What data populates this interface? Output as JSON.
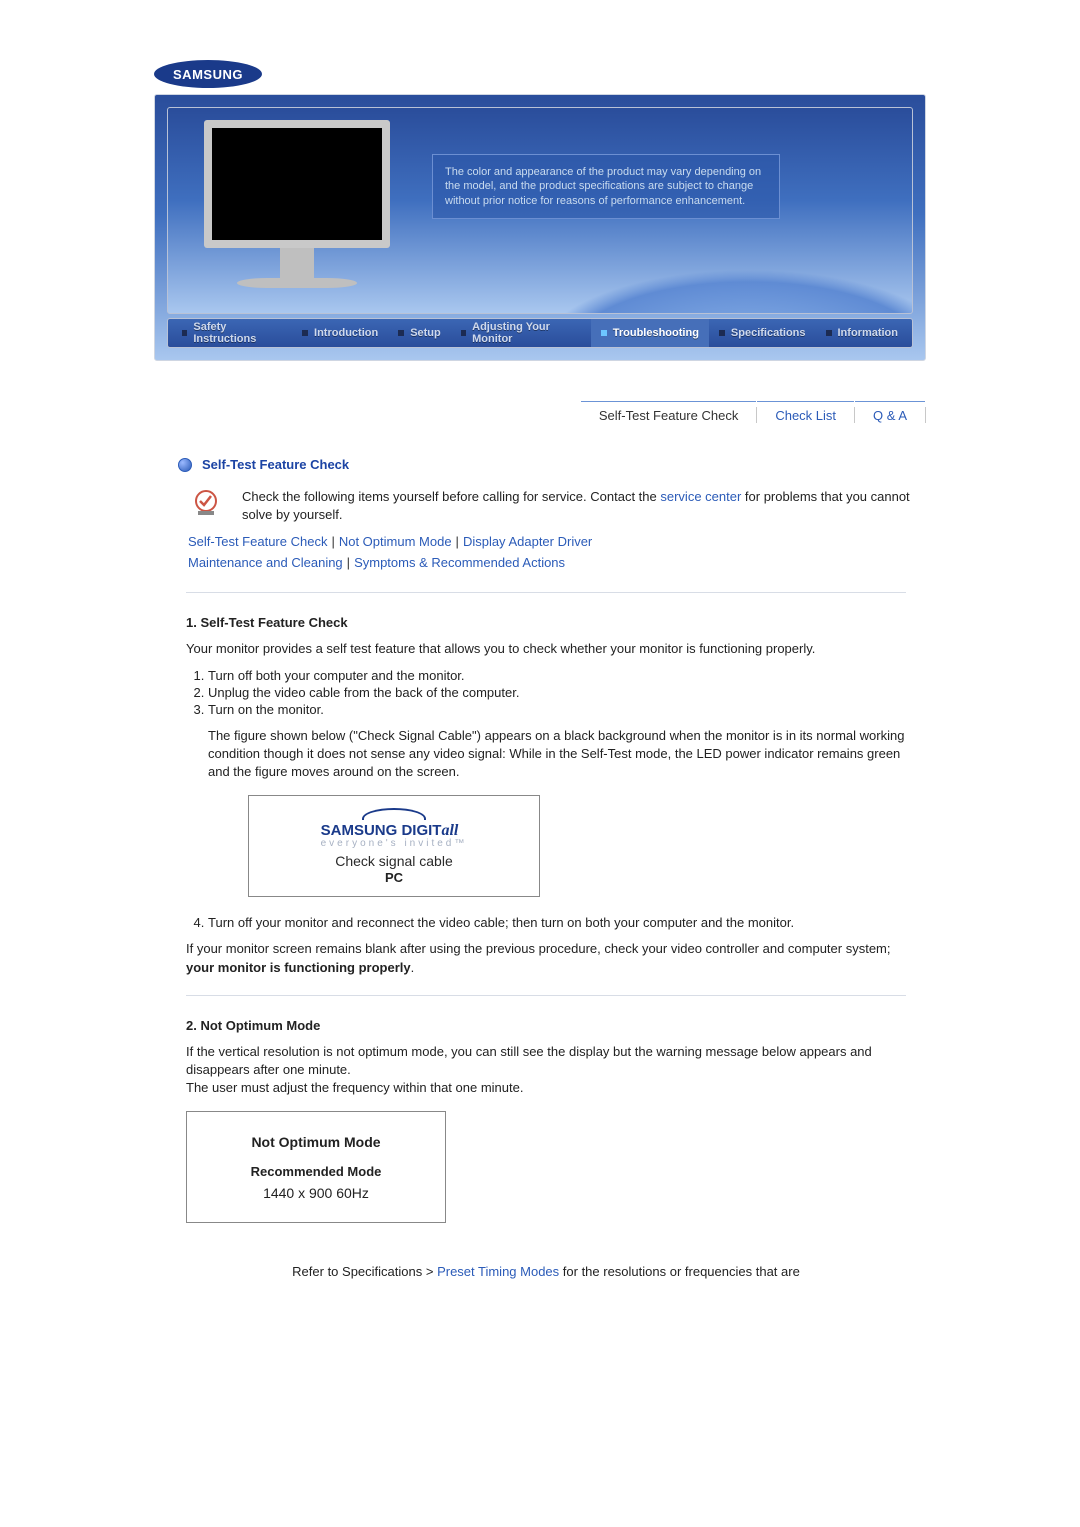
{
  "brand": "SAMSUNG",
  "hero_caption": "The color and appearance of the product may vary depending on the model, and the product specifications are subject to change without prior notice for reasons of performance enhancement.",
  "nav": {
    "items": [
      "Safety Instructions",
      "Introduction",
      "Setup",
      "Adjusting Your Monitor",
      "Troubleshooting",
      "Specifications",
      "Information"
    ],
    "active_index": 4
  },
  "subnav": {
    "items": [
      "Self-Test Feature Check",
      "Check List",
      "Q & A"
    ],
    "active_index": 0
  },
  "section": {
    "title": "Self-Test Feature Check",
    "intro_pre": "Check the following items yourself before calling for service. Contact the ",
    "intro_link": "service center",
    "intro_post": " for problems that you cannot solve by yourself.",
    "anchors_row1": [
      "Self-Test Feature Check",
      "Not Optimum Mode",
      "Display Adapter Driver"
    ],
    "anchors_row2": [
      "Maintenance and Cleaning",
      "Symptoms & Recommended Actions"
    ]
  },
  "selftest": {
    "heading": "1. Self-Test Feature Check",
    "intro": "Your monitor provides a self test feature that allows you to check whether your monitor is functioning properly.",
    "steps_1to3": [
      "Turn off both your computer and the monitor.",
      "Unplug the video cable from the back of the computer.",
      "Turn on the monitor."
    ],
    "figure_note": "The figure shown below (\"Check Signal Cable\") appears on a black background when the monitor is in its normal working condition though it does not sense any video signal: While in the Self-Test mode, the LED power indicator remains green and the figure moves around on the screen.",
    "figure": {
      "brand_main": "SAMSUNG DIGIT",
      "brand_suffix": "all",
      "tagline": "everyone's invited™",
      "line1": "Check signal cable",
      "line2": "PC"
    },
    "step4": "Turn off your monitor and reconnect the video cable; then turn on both your computer and the monitor.",
    "after_pre": "If your monitor screen remains blank after using the previous procedure, check your video controller and computer system; ",
    "after_bold": "your monitor is functioning properly",
    "after_post": "."
  },
  "notoptimum": {
    "heading": "2. Not Optimum Mode",
    "p1": "If the vertical resolution is not optimum mode, you can still see the display but the warning message below appears and disappears after one minute.",
    "p2": "The user must adjust the frequency within that one minute.",
    "box": {
      "l1": "Not Optimum Mode",
      "l2": "Recommended Mode",
      "l3": "1440 x 900   60Hz"
    },
    "after_pre": "Refer to Specifications > ",
    "after_link": "Preset Timing Modes",
    "after_post": " for the resolutions or frequencies that are"
  }
}
